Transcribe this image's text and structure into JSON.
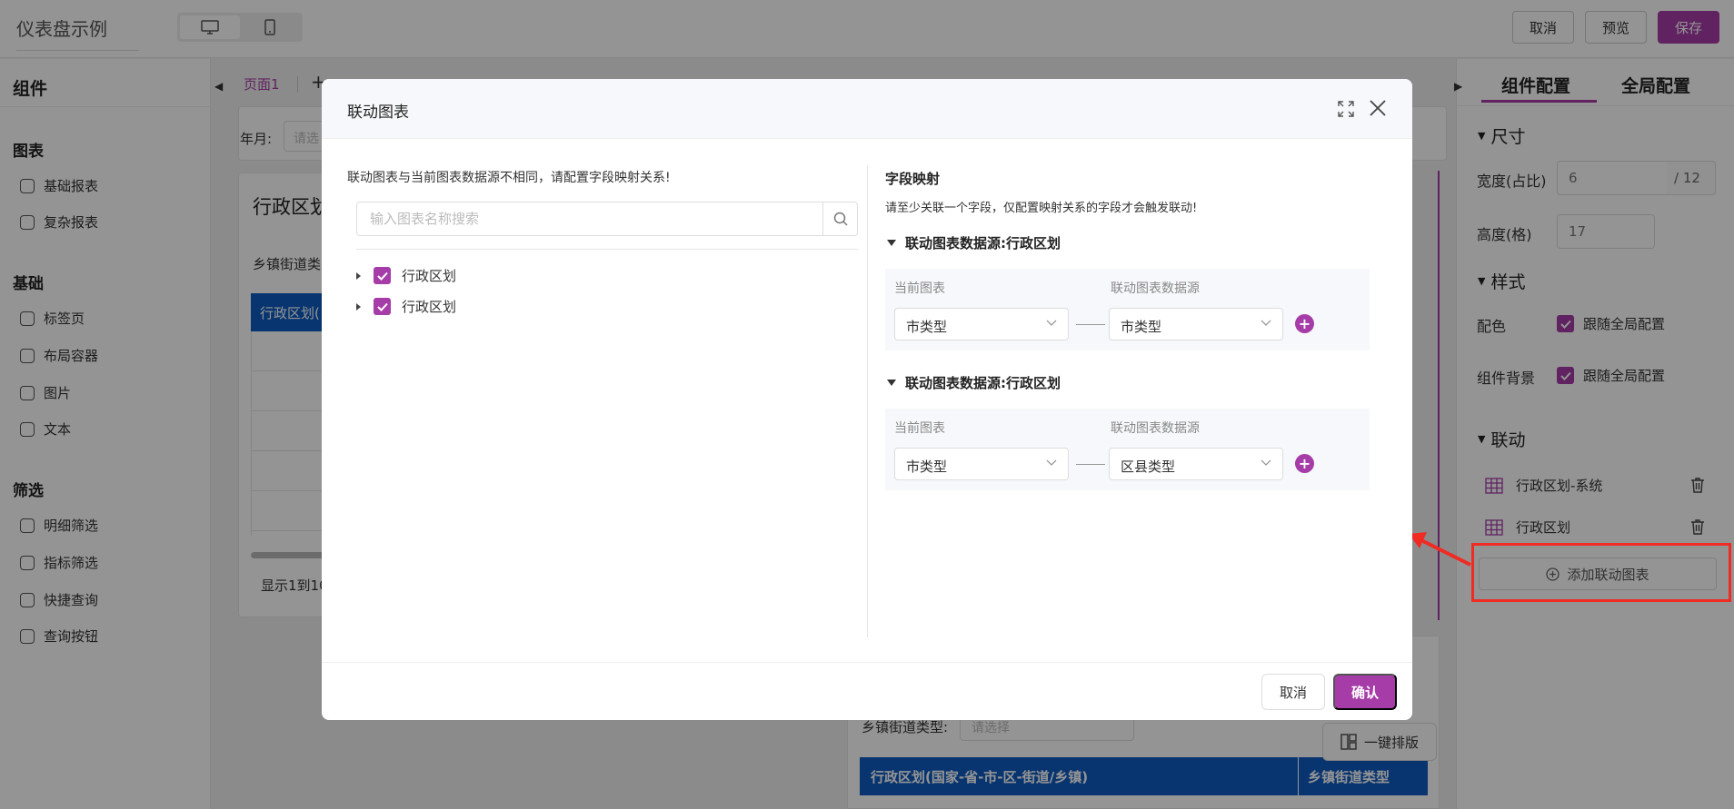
{
  "app": {
    "title": "仪表盘示例",
    "actions": {
      "cancel": "取消",
      "preview": "预览",
      "save": "保存"
    }
  },
  "left_panel": {
    "title": "组件",
    "sections": [
      {
        "label": "图表",
        "items": [
          "基础报表",
          "复杂报表"
        ]
      },
      {
        "label": "基础",
        "items": [
          "标签页",
          "布局容器",
          "图片",
          "文本"
        ]
      },
      {
        "label": "筛选",
        "items": [
          "明细筛选",
          "指标筛选",
          "快捷查询",
          "查询按钮"
        ]
      }
    ]
  },
  "canvas": {
    "page_tab": "页面1",
    "add_page": "+",
    "year_label": "年月:",
    "year_placeholder": "请选",
    "chart_title": "行政区划",
    "chart_sub": "乡镇街道类",
    "chart_header": "行政区划(",
    "chart_footer": "显示1到10",
    "bottom_label": "乡镇街道类型:",
    "bottom_placeholder": "请选择",
    "bottom_col1": "行政区划(国家-省-市-区-街道/乡镇)",
    "bottom_col2": "乡镇街道类型",
    "auto_layout": "一键排版"
  },
  "right_panel": {
    "tabs": [
      "组件配置",
      "全局配置"
    ],
    "size_section": "尺寸",
    "width_label": "宽度(占比)",
    "width_value": "6",
    "width_suffix": "/ 12",
    "height_label": "高度(格)",
    "height_value": "17",
    "style_section": "样式",
    "color_label": "配色",
    "color_option": "跟随全局配置",
    "bg_label": "组件背景",
    "bg_option": "跟随全局配置",
    "link_section": "联动",
    "link_items": [
      "行政区划-系统",
      "行政区划"
    ],
    "add_link": "添加联动图表"
  },
  "modal": {
    "title": "联动图表",
    "left_desc": "联动图表与当前图表数据源不相同，请配置字段映射关系!",
    "search_placeholder": "输入图表名称搜索",
    "tree_items": [
      "行政区划",
      "行政区划"
    ],
    "mapping_title": "字段映射",
    "mapping_desc": "请至少关联一个字段，仅配置映射关系的字段才会触发联动!",
    "datasources": [
      {
        "title": "联动图表数据源:行政区划",
        "current_label": "当前图表",
        "linked_label": "联动图表数据源",
        "current_value": "市类型",
        "linked_value": "市类型"
      },
      {
        "title": "联动图表数据源:行政区划",
        "current_label": "当前图表",
        "linked_label": "联动图表数据源",
        "current_value": "市类型",
        "linked_value": "区县类型"
      }
    ],
    "cancel": "取消",
    "confirm": "确认"
  },
  "colors": {
    "accent": "#a63ca8",
    "table_header": "#0f5cc2",
    "highlight": "#ef2b24"
  }
}
